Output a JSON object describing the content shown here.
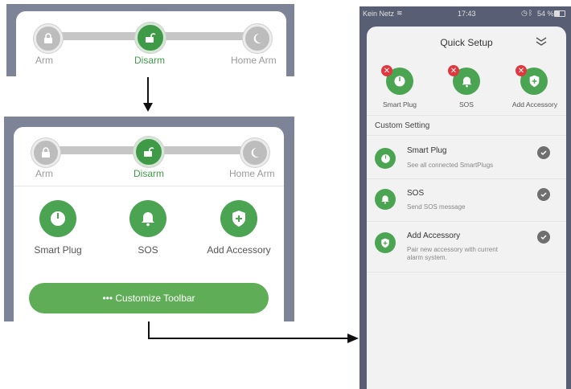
{
  "top_panel": {
    "modes": [
      "Arm",
      "Disarm",
      "Home Arm"
    ]
  },
  "middle_panel": {
    "modes": [
      "Arm",
      "Disarm",
      "Home Arm"
    ],
    "quick_buttons": [
      "Smart Plug",
      "SOS",
      "Add Accessory"
    ],
    "customize_button": "••• Customize Toolbar"
  },
  "phone": {
    "status": {
      "carrier": "Kein Netz",
      "time": "17:43",
      "battery": "54 %"
    },
    "title": "Quick Setup",
    "quick_buttons": [
      "Smart Plug",
      "SOS",
      "Add Accessory"
    ],
    "section_header": "Custom Setting",
    "items": [
      {
        "title": "Smart Plug",
        "subtitle": "See all connected SmartPlugs",
        "icon": "power-icon"
      },
      {
        "title": "SOS",
        "subtitle": "Send SOS message",
        "icon": "bell-icon"
      },
      {
        "title": "Add Accessory",
        "subtitle": "Pair new accessory with current",
        "subtitle2": "alarm system.",
        "icon": "shield-plus-icon"
      }
    ]
  },
  "colors": {
    "accent_green": "#4aa452",
    "active_green": "#3f9a47",
    "delete_red": "#e0383e",
    "slate": "#7d8497"
  }
}
